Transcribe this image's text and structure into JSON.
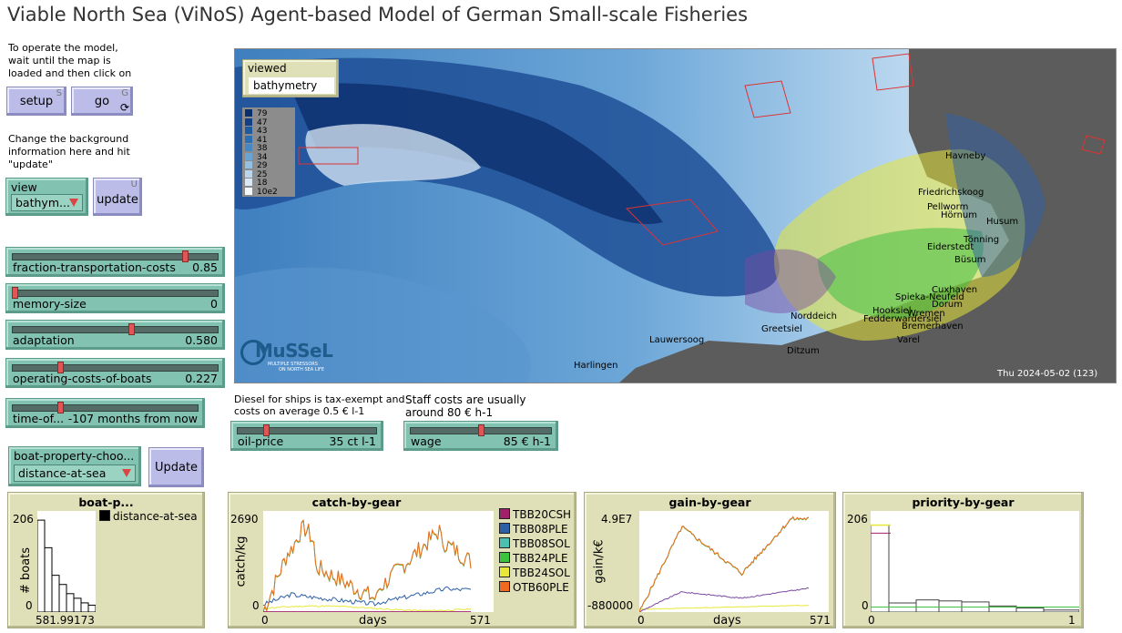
{
  "title": "Viable North Sea (ViNoS) Agent-based Model of German Small-scale Fisheries",
  "notes": {
    "operate": [
      "To operate the model,",
      "wait until the map is",
      "loaded and then click on"
    ],
    "background": [
      "Change the background",
      "information here and hit",
      "\"update\""
    ],
    "diesel": [
      "Diesel for ships is tax-exempt and",
      "costs on average 0.5 € l-1"
    ],
    "staff": [
      "Staff costs are usually",
      "around 80 € h-1"
    ]
  },
  "buttons": {
    "setup": {
      "label": "setup",
      "key": "S"
    },
    "go": {
      "label": "go",
      "key": "G"
    },
    "update": {
      "label": "update",
      "key": "U"
    },
    "update2": {
      "label": "Update"
    }
  },
  "view_chooser": {
    "label": "view",
    "value": "bathym..."
  },
  "boat_chooser": {
    "label": "boat-property-choo...",
    "value": "distance-at-sea"
  },
  "sliders": [
    {
      "label": "fraction-transportation-costs",
      "value": "0.85",
      "level": 0.85
    },
    {
      "label": "memory-size",
      "value": "0",
      "level": 0.0
    },
    {
      "label": "adaptation",
      "value": "0.580",
      "level": 0.58
    },
    {
      "label": "operating-costs-of-boats",
      "value": "0.227",
      "level": 0.227
    },
    {
      "label": "time-of...",
      "value": "-107 months from now",
      "level": 0.25
    },
    {
      "label": "oil-price",
      "value": "35 ct l-1",
      "level": 0.2
    },
    {
      "label": "wage",
      "value": "85 € h-1",
      "level": 0.5
    }
  ],
  "map": {
    "viewed_label": "viewed",
    "viewed_value": "bathymetry",
    "legend_values": [
      "79",
      "47",
      "43",
      "41",
      "38",
      "34",
      "29",
      "25",
      "18",
      "10e2"
    ],
    "legend_colors": [
      "#0b2e6e",
      "#123f85",
      "#1d5aa0",
      "#2c6fb4",
      "#4688c4",
      "#6aa4d4",
      "#92bfe2",
      "#b9d6ee",
      "#dae9f6",
      "#f2f8fc"
    ],
    "timestamp": "Thu 2024-05-02 (123)",
    "logo_text": "MuSSeL",
    "logo_subtitle": [
      "MULTIPLE STRESSORS",
      "ON NORTH SEA LIFE"
    ],
    "ports": [
      "Havneby",
      "Husum",
      "Hörnum",
      "Büsum",
      "Friedrichskoog",
      "Tönning",
      "Cuxhaven",
      "Spieka-Neufeld",
      "Dorum",
      "Wremen",
      "Bremerhaven",
      "Fedderwardersiel",
      "Varel",
      "Hooksiel",
      "Norddeich",
      "Greetsiel",
      "Ditzum",
      "Lauwersoog",
      "Harlingen",
      "Eiderstedt",
      "Pellworm"
    ]
  },
  "plots": {
    "boat": {
      "title": "boat-p...",
      "ylabel": "# boats",
      "ymax": "206",
      "ymin": "0",
      "xmax_label": "581.99173",
      "legend": "distance-at-sea",
      "bars": [
        0.2,
        0.14,
        0.08,
        0.06,
        0.04,
        0.03,
        0.02,
        0.015
      ]
    },
    "catch": {
      "title": "catch-by-gear",
      "ylabel": "catch/kg",
      "xlabel": "days",
      "ymax": "2690",
      "ymin": "0",
      "xmin": "0",
      "xmax": "571",
      "legend": [
        {
          "name": "TBB20CSH",
          "color": "#a0206a"
        },
        {
          "name": "TBB08PLE",
          "color": "#2d5fa6"
        },
        {
          "name": "TBB08SOL",
          "color": "#4cc0b0"
        },
        {
          "name": "TBB24PLE",
          "color": "#3cc43c"
        },
        {
          "name": "TBB24SOL",
          "color": "#e8e83a"
        },
        {
          "name": "OTB60PLE",
          "color": "#ef6a1e"
        }
      ]
    },
    "gain": {
      "title": "gain-by-gear",
      "ylabel": "gain/k€",
      "xlabel": "days",
      "ymax": "4.9E7",
      "ymin": "-880000",
      "xmin": "0",
      "xmax": "571"
    },
    "priority": {
      "title": "priority-by-gear",
      "ymax": "206",
      "ymin": "0",
      "xmin": "0",
      "xmax": "1"
    }
  }
}
